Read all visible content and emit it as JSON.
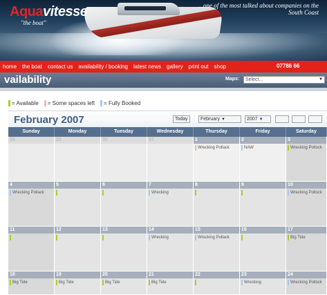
{
  "brand": {
    "name_part1": "Aqua",
    "name_part2": "vitesse",
    "subtitle": "\"the boat\""
  },
  "banner": {
    "tagline": "...one of the most talked about companies on the South Coast"
  },
  "nav": {
    "items": [
      {
        "label": "home"
      },
      {
        "label": "the boat"
      },
      {
        "label": "contact us"
      },
      {
        "label": "availability / booking"
      },
      {
        "label": "latest news"
      },
      {
        "label": "gallery"
      },
      {
        "label": "print out"
      },
      {
        "label": "shop"
      }
    ],
    "phone": "07786 66"
  },
  "page": {
    "title": "vailability"
  },
  "maps": {
    "label": "Maps:",
    "placeholder": "Select..."
  },
  "legend": {
    "available": {
      "label": "= Available",
      "color": "#a6d21e"
    },
    "some": {
      "label": "= Some spaces left",
      "color": "#f4b6b6"
    },
    "full": {
      "label": "= Fully Booked",
      "color": "#a9c8e8"
    }
  },
  "calendar": {
    "title": "February 2007",
    "controls": {
      "today": "Today",
      "month": "February",
      "year": "2007"
    },
    "weekdays": [
      "Sunday",
      "Monday",
      "Tuesday",
      "Wednesday",
      "Thursday",
      "Friday",
      "Saturday"
    ],
    "weeks": [
      [
        {
          "day": "28",
          "state": "empty",
          "events": []
        },
        {
          "day": "29",
          "state": "empty",
          "events": []
        },
        {
          "day": "30",
          "state": "empty",
          "events": []
        },
        {
          "day": "31",
          "state": "empty",
          "events": []
        },
        {
          "day": "1",
          "state": "active",
          "events": [
            {
              "label": "Wrecking Pollack",
              "status": "some"
            }
          ]
        },
        {
          "day": "2",
          "state": "active",
          "events": [
            {
              "label": "NAW",
              "status": "full"
            }
          ]
        },
        {
          "day": "3",
          "state": "weekend",
          "events": [
            {
              "label": "Wrecking Pollock",
              "status": "available"
            }
          ]
        }
      ],
      [
        {
          "day": "4",
          "state": "weekend",
          "events": [
            {
              "label": "Wrecking Pollack",
              "status": "full"
            }
          ]
        },
        {
          "day": "5",
          "state": "normal",
          "events": [
            {
              "label": "",
              "status": "available"
            }
          ]
        },
        {
          "day": "6",
          "state": "normal",
          "events": [
            {
              "label": "",
              "status": "available"
            }
          ]
        },
        {
          "day": "7",
          "state": "normal",
          "events": [
            {
              "label": "Wrecking",
              "status": "full"
            }
          ]
        },
        {
          "day": "8",
          "state": "normal",
          "events": [
            {
              "label": "",
              "status": "available"
            }
          ]
        },
        {
          "day": "9",
          "state": "normal",
          "events": [
            {
              "label": "",
              "status": "available"
            }
          ]
        },
        {
          "day": "10",
          "state": "weekend",
          "events": [
            {
              "label": "Wrecking Pollock",
              "status": "full"
            }
          ]
        }
      ],
      [
        {
          "day": "11",
          "state": "weekend",
          "events": [
            {
              "label": "",
              "status": "available"
            }
          ]
        },
        {
          "day": "12",
          "state": "normal",
          "events": [
            {
              "label": "",
              "status": "available"
            }
          ]
        },
        {
          "day": "13",
          "state": "normal",
          "events": [
            {
              "label": "",
              "status": "available"
            }
          ]
        },
        {
          "day": "14",
          "state": "normal",
          "events": [
            {
              "label": "Wrecking",
              "status": "full"
            }
          ]
        },
        {
          "day": "15",
          "state": "normal",
          "events": [
            {
              "label": "Wrecking Pollack",
              "status": "full"
            }
          ]
        },
        {
          "day": "16",
          "state": "normal",
          "events": [
            {
              "label": "",
              "status": "available"
            }
          ]
        },
        {
          "day": "17",
          "state": "weekend",
          "events": [
            {
              "label": "Big Tide",
              "status": "available"
            }
          ]
        }
      ],
      [
        {
          "day": "18",
          "state": "weekend",
          "events": [
            {
              "label": "Big Tide",
              "status": "available"
            }
          ]
        },
        {
          "day": "19",
          "state": "normal",
          "events": [
            {
              "label": "Big Tide",
              "status": "available"
            }
          ]
        },
        {
          "day": "20",
          "state": "normal",
          "events": [
            {
              "label": "Big Tide",
              "status": "available"
            }
          ]
        },
        {
          "day": "21",
          "state": "normal",
          "events": [
            {
              "label": "Big Tide",
              "status": "available"
            }
          ]
        },
        {
          "day": "22",
          "state": "normal",
          "events": [
            {
              "label": "",
              "status": "available"
            }
          ]
        },
        {
          "day": "23",
          "state": "normal",
          "events": [
            {
              "label": "Wrecking",
              "status": "full"
            }
          ]
        },
        {
          "day": "24",
          "state": "weekend",
          "events": [
            {
              "label": "Wrecking Pollock",
              "status": "full"
            }
          ]
        }
      ]
    ]
  }
}
